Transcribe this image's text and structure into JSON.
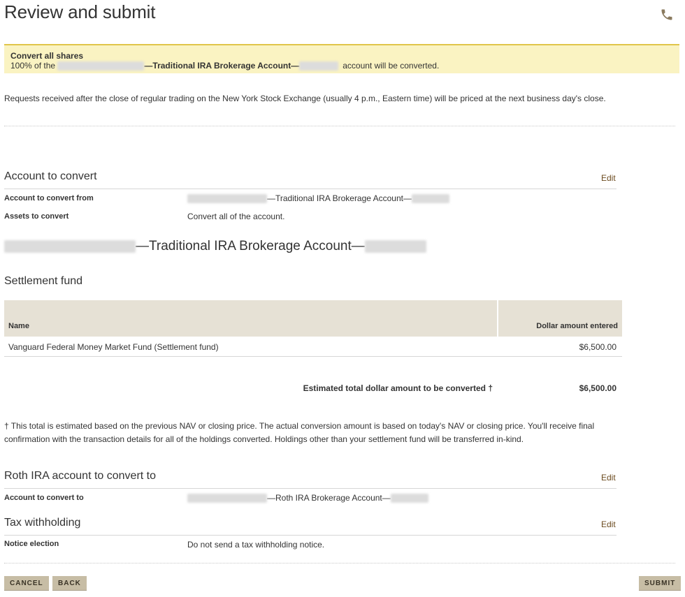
{
  "header": {
    "title": "Review and submit",
    "phone_icon": "phone-icon"
  },
  "alert": {
    "title": "Convert all shares",
    "msg_prefix": "100% of the",
    "msg_account": "—Traditional IRA Brokerage Account—",
    "msg_suffix": "account will be converted."
  },
  "notice": "Requests received after the close of regular trading on the New York Stock Exchange (usually 4 p.m., Eastern time) will be priced at the next business day's close.",
  "account_to_convert": {
    "title": "Account to convert",
    "edit_label": "Edit",
    "rows": [
      {
        "label": "Account to convert from",
        "value": "—Traditional IRA Brokerage Account—"
      },
      {
        "label": "Assets to convert",
        "value": "Convert all of the account."
      }
    ]
  },
  "account_heading": "—Traditional IRA Brokerage Account—",
  "settlement": {
    "title": "Settlement fund",
    "col_name": "Name",
    "col_amount": "Dollar amount entered",
    "fund_name": "Vanguard Federal Money Market Fund  (Settlement fund)",
    "fund_amount": "$6,500.00",
    "total_label": "Estimated total dollar amount to be converted †",
    "total_value": "$6,500.00"
  },
  "footnote": "† This total is estimated based on the previous NAV or closing price. The actual conversion amount is based on today's NAV or closing price. You'll receive final confirmation with the transaction details for all of the holdings converted. Holdings other than your settlement fund will be transferred in-kind.",
  "roth": {
    "title": "Roth IRA account to convert to",
    "edit_label": "Edit",
    "label": "Account to convert to",
    "value": "—Roth IRA Brokerage Account—"
  },
  "tax": {
    "title": "Tax withholding",
    "edit_label": "Edit",
    "label": "Notice election",
    "value": "Do not send a tax withholding notice."
  },
  "buttons": {
    "cancel": "CANCEL",
    "back": "BACK",
    "submit": "SUBMIT"
  }
}
